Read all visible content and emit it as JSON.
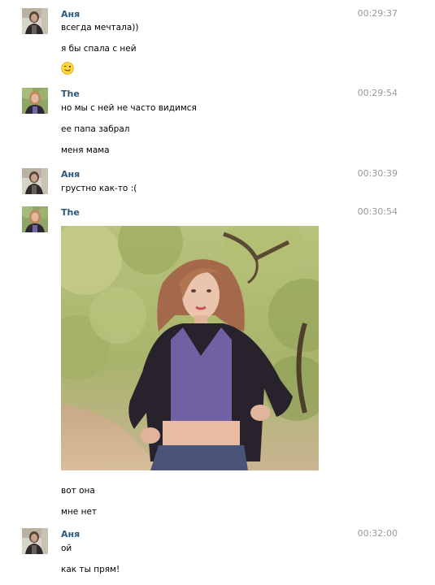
{
  "messages": [
    {
      "author": "Аня",
      "time": "00:29:37",
      "lines": [
        "всегда мечтала))",
        "я бы спала с ней"
      ],
      "emoji": "winking-tongue-emoji"
    },
    {
      "author": "The",
      "time": "00:29:54",
      "lines": [
        "но мы с ней не часто видимся",
        "ее папа забрал",
        "меня мама"
      ]
    },
    {
      "author": "Аня",
      "time": "00:30:39",
      "lines": [
        "грустно как-то :("
      ]
    },
    {
      "author": "The",
      "time": "00:30:54",
      "lines": [
        "вот она",
        "мне нет"
      ],
      "photo": "girl-in-leather-jacket-photo"
    },
    {
      "author": "Аня",
      "time": "00:32:00",
      "lines": [
        "ой",
        "как ты прям!"
      ]
    }
  ],
  "colors": {
    "author": "#2b587a",
    "time": "#999999",
    "text": "#000000",
    "background": "#ffffff"
  }
}
